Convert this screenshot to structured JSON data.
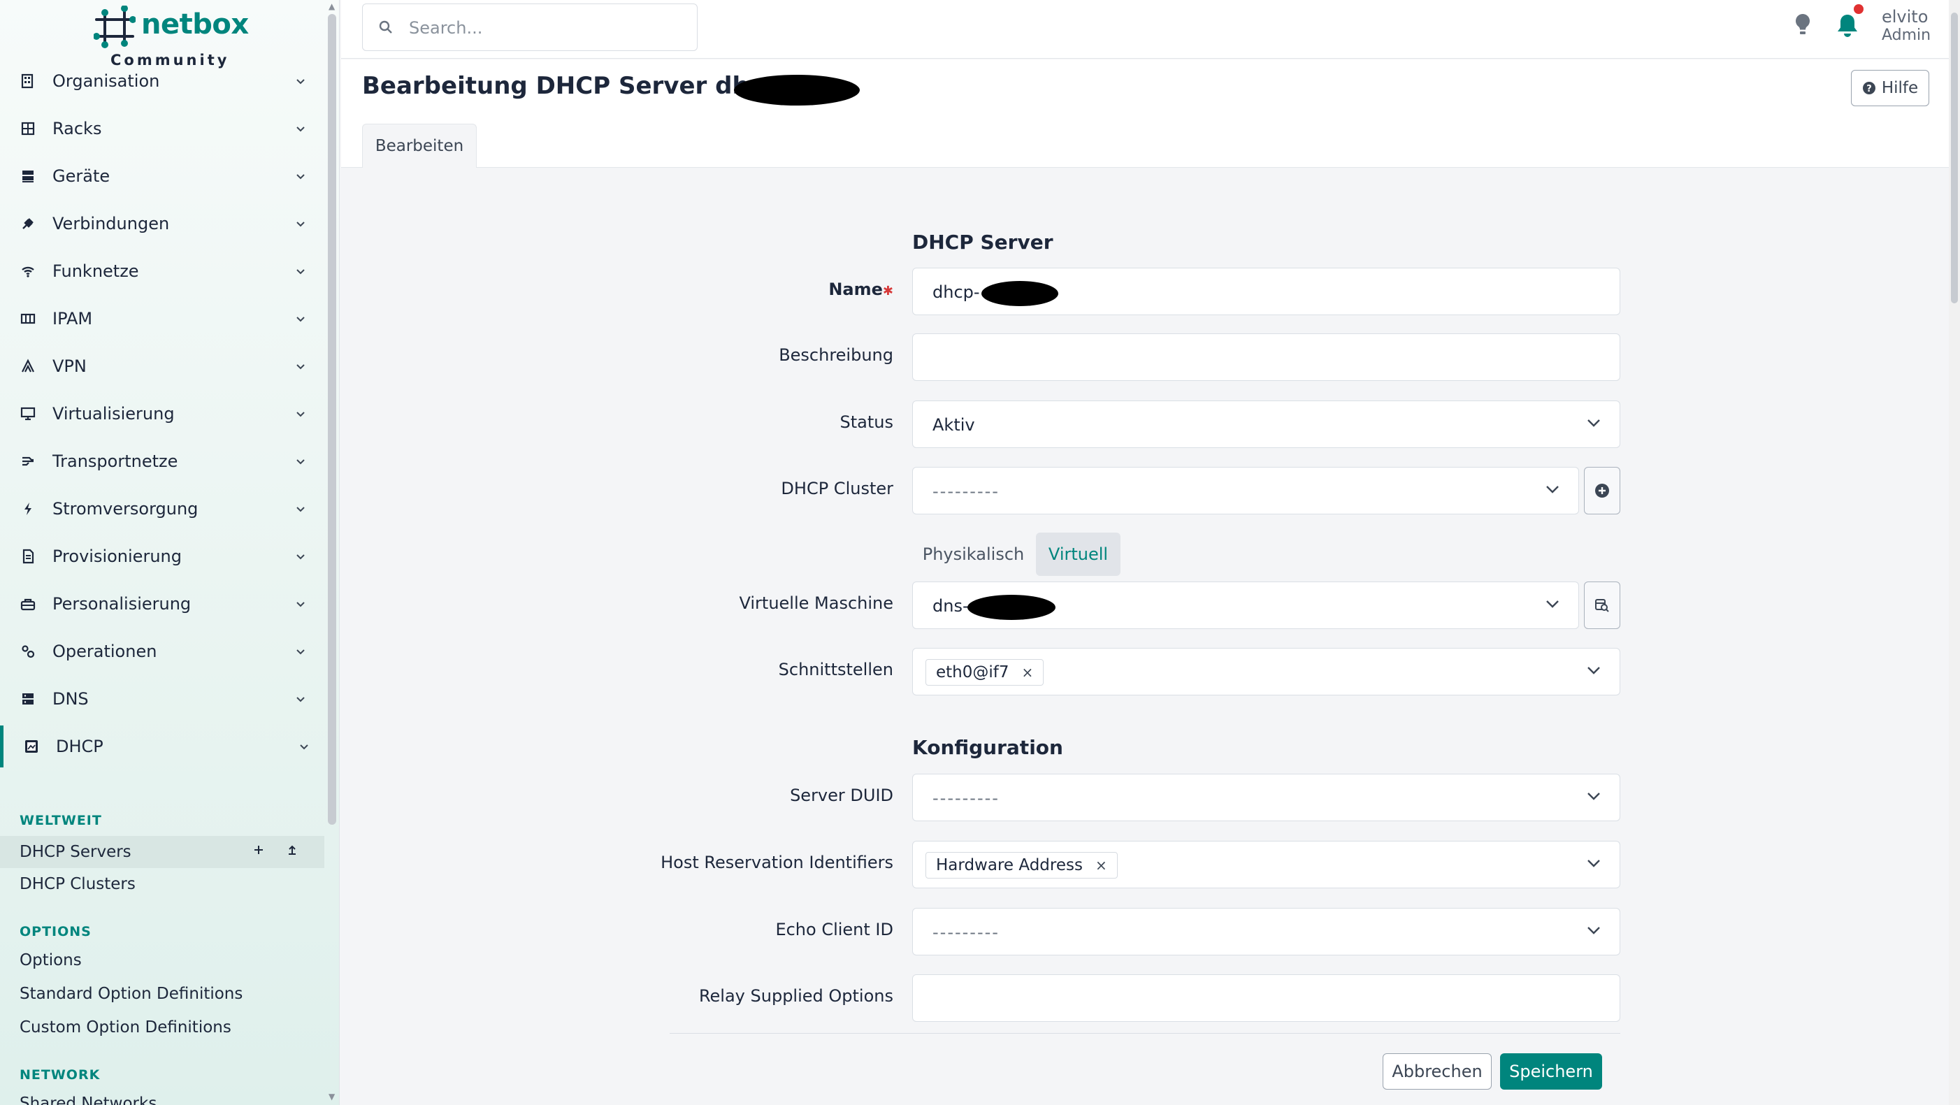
{
  "brand": {
    "name": "netbox",
    "edition": "Community"
  },
  "sidebar": {
    "menu": [
      {
        "label": "Organisation",
        "icon": "building-icon"
      },
      {
        "label": "Racks",
        "icon": "rack-icon"
      },
      {
        "label": "Geräte",
        "icon": "server-icon"
      },
      {
        "label": "Verbindungen",
        "icon": "plug-icon"
      },
      {
        "label": "Funknetze",
        "icon": "wifi-icon"
      },
      {
        "label": "IPAM",
        "icon": "counter-icon"
      },
      {
        "label": "VPN",
        "icon": "tunnel-icon"
      },
      {
        "label": "Virtualisierung",
        "icon": "monitor-icon"
      },
      {
        "label": "Transportnetze",
        "icon": "circuit-icon"
      },
      {
        "label": "Stromversorgung",
        "icon": "bolt-icon"
      },
      {
        "label": "Provisionierung",
        "icon": "file-icon"
      },
      {
        "label": "Personalisierung",
        "icon": "toolbox-icon"
      },
      {
        "label": "Operationen",
        "icon": "cogs-icon"
      },
      {
        "label": "DNS",
        "icon": "dns-icon"
      },
      {
        "label": "DHCP",
        "icon": "dhcp-icon"
      }
    ],
    "sections": {
      "global": "WELTWEIT",
      "options": "OPTIONS",
      "network": "NETWORK"
    },
    "global_items": [
      "DHCP Servers",
      "DHCP Clusters"
    ],
    "options_items": [
      "Options",
      "Standard Option Definitions",
      "Custom Option Definitions"
    ],
    "network_items": [
      "Shared Networks"
    ]
  },
  "header": {
    "search_placeholder": "Search...",
    "user_name": "elvito",
    "user_role": "Admin"
  },
  "page": {
    "title": "Bearbeitung DHCP Server dhcp-",
    "help_label": "Hilfe",
    "tab_edit": "Bearbeiten"
  },
  "form": {
    "section_server": "DHCP Server",
    "name_label": "Name",
    "name_value": "dhcp-",
    "description_label": "Beschreibung",
    "description_value": "",
    "status_label": "Status",
    "status_value": "Aktiv",
    "cluster_label": "DHCP Cluster",
    "cluster_value": "---------",
    "toggle_physical": "Physikalisch",
    "toggle_virtual": "Virtuell",
    "vm_label": "Virtuelle Maschine",
    "vm_value": "dns-",
    "interfaces_label": "Schnittstellen",
    "interfaces_tags": [
      "eth0@if7"
    ],
    "section_config": "Konfiguration",
    "duid_label": "Server DUID",
    "duid_value": "---------",
    "hri_label": "Host Reservation Identifiers",
    "hri_tags": [
      "Hardware Address"
    ],
    "echo_label": "Echo Client ID",
    "echo_value": "---------",
    "relay_label": "Relay Supplied Options",
    "relay_value": "",
    "cancel_label": "Abbrechen",
    "save_label": "Speichern"
  },
  "colors": {
    "accent": "#00857d",
    "notification": "#e03131",
    "required": "#d63939"
  }
}
